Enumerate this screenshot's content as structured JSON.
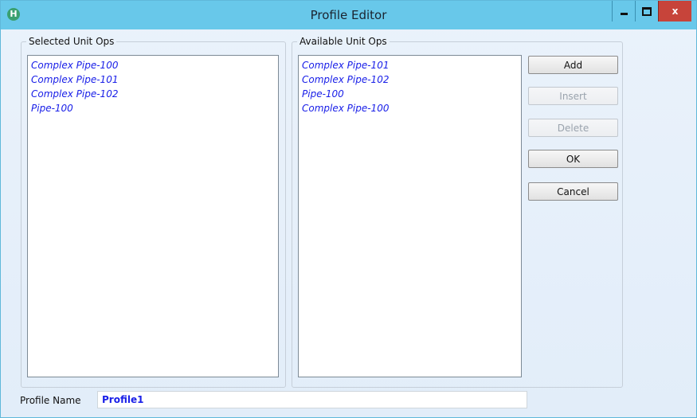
{
  "window": {
    "title": "Profile Editor",
    "app_icon": "H",
    "controls": {
      "minimize": "minimize-icon",
      "maximize": "maximize-icon",
      "close": "x"
    }
  },
  "selected_group": {
    "legend": "Selected Unit Ops",
    "items": [
      "Complex Pipe-100",
      "Complex Pipe-101",
      "Complex Pipe-102",
      "Pipe-100"
    ]
  },
  "available_group": {
    "legend": "Available Unit Ops",
    "items": [
      "Complex Pipe-101",
      "Complex Pipe-102",
      "Pipe-100",
      "Complex Pipe-100"
    ]
  },
  "buttons": {
    "add": "Add",
    "insert": "Insert",
    "delete": "Delete",
    "ok": "OK",
    "cancel": "Cancel"
  },
  "profile": {
    "label": "Profile Name",
    "value": "Profile1"
  },
  "colors": {
    "titlebar": "#68c8ea",
    "list_text": "#1a20e8",
    "close_button": "#c7443a"
  }
}
